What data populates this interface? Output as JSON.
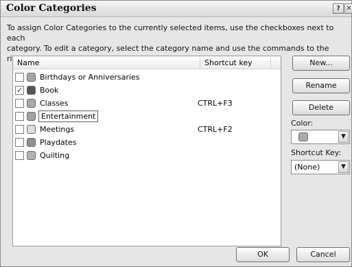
{
  "dialog": {
    "title": "Color Categories",
    "help_glyph": "?",
    "close_glyph": "✕",
    "instructions_line1": "To assign Color Categories to the currently selected items, use the checkboxes next to each",
    "instructions_line2": "category.  To edit a category, select the category name and use the commands to the right."
  },
  "list": {
    "col_name": "Name",
    "col_shortcut": "Shortcut key",
    "rows": [
      {
        "name": "Birthdays or Anniversaries",
        "shortcut": "",
        "checked": false,
        "color": "#a7a7a7"
      },
      {
        "name": "Book",
        "shortcut": "",
        "checked": true,
        "color": "#555555"
      },
      {
        "name": "Classes",
        "shortcut": "CTRL+F3",
        "checked": false,
        "color": "#a9a9a9"
      },
      {
        "name": "Entertainment",
        "shortcut": "",
        "checked": false,
        "color": "#a3a3a3"
      },
      {
        "name": "Meetings",
        "shortcut": "CTRL+F2",
        "checked": false,
        "color": "#dedede"
      },
      {
        "name": "Playdates",
        "shortcut": "",
        "checked": false,
        "color": "#8f8f8f"
      },
      {
        "name": "Quilting",
        "shortcut": "",
        "checked": false,
        "color": "#b3b3b3"
      }
    ]
  },
  "buttons": {
    "new": "New...",
    "rename": "Rename",
    "delete": "Delete",
    "ok": "OK",
    "cancel": "Cancel"
  },
  "color": {
    "label": "Color:",
    "selected_color": "#ababab",
    "arrow_glyph": "▼"
  },
  "shortcut": {
    "label": "Shortcut Key:",
    "value": "(None)",
    "arrow_glyph": "▼"
  }
}
